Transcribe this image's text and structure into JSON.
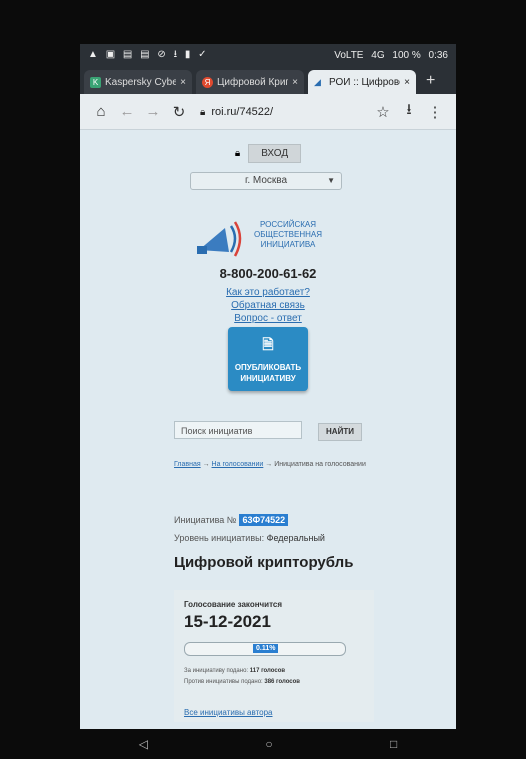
{
  "status_bar": {
    "left_icons": [
      "▲",
      "▣",
      "▤",
      "▤",
      "⊘",
      "⭳",
      "▮",
      "✓"
    ],
    "volte": "VoLTE",
    "network": "4G",
    "battery": "100 %",
    "time": "0:36"
  },
  "tabs": [
    {
      "title": "Kaspersky Cyber",
      "icon_color": "#3aa374",
      "icon": "K"
    },
    {
      "title": "Цифровой Крип",
      "icon_color": "#e04a2f",
      "icon": "Я"
    },
    {
      "title": "РОИ :: Цифрово",
      "icon_color": "#2a6db0",
      "icon": "◢"
    }
  ],
  "toolbar": {
    "url": "roi.ru/74522/"
  },
  "page": {
    "login_label": "ВХОД",
    "city": "г. Москва",
    "logo_text_1": "РОССИЙСКАЯ",
    "logo_text_2": "ОБЩЕСТВЕННАЯ",
    "logo_text_3": "ИНИЦИАТИВА",
    "phone": "8-800-200-61-62",
    "link_how": "Как это работает?",
    "link_feedback": "Обратная связь",
    "link_faq": "Вопрос - ответ",
    "publish_line1": "ОПУБЛИКОВАТЬ",
    "publish_line2": "ИНИЦИАТИВУ",
    "search_placeholder": "Поиск инициатив",
    "find_label": "НАЙТИ",
    "crumb_home": "Главная",
    "crumb_voting": "На голосовании",
    "crumb_current": "Инициатива на голосовании",
    "init_label": "Инициатива №",
    "init_number": "63Ф74522",
    "level_label": "Уровень инициативы:",
    "level_value": "Федеральный",
    "title": "Цифровой крипторубль",
    "vote_label": "Голосование закончится",
    "vote_date": "15-12-2021",
    "progress": 0.11,
    "progress_text": "0.11%",
    "vote_for_label": "За инициативу подано:",
    "vote_for_value": "117 голосов",
    "vote_against_label": "Против инициативы подано:",
    "vote_against_value": "386 голосов",
    "author_link": "Все инициативы автора"
  }
}
